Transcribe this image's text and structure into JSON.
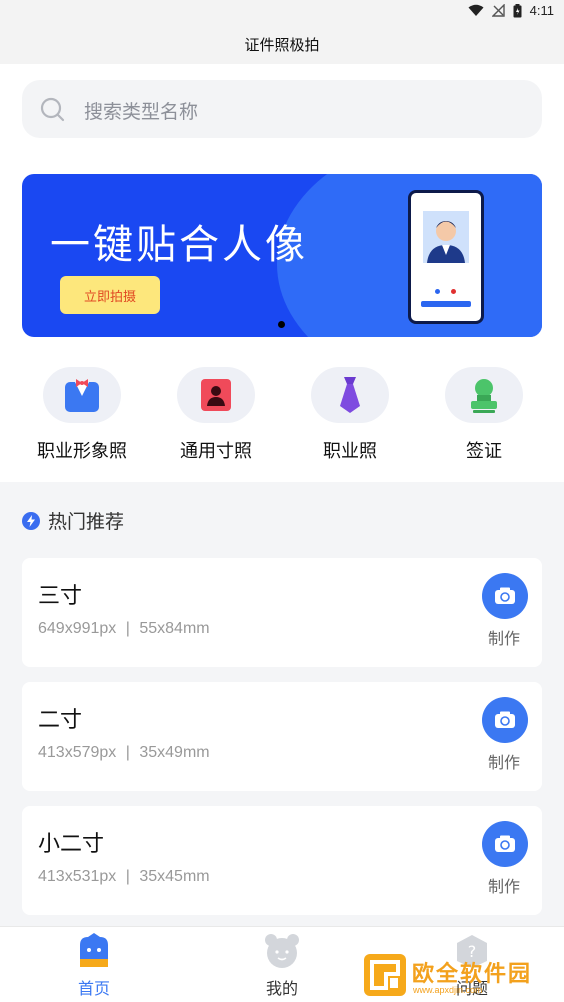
{
  "status": {
    "time": "4:11"
  },
  "header": {
    "title": "证件照极拍"
  },
  "search": {
    "placeholder": "搜索类型名称"
  },
  "banner": {
    "title": "一键贴合人像",
    "button_label": "立即拍摄",
    "colors": {
      "background": "#1a48f2",
      "button": "#fde77c"
    }
  },
  "categories": [
    {
      "label": "职业形象照",
      "icon": "suit-bowtie-icon"
    },
    {
      "label": "通用寸照",
      "icon": "id-photo-icon"
    },
    {
      "label": "职业照",
      "icon": "tie-icon"
    },
    {
      "label": "签证",
      "icon": "stamp-icon"
    }
  ],
  "section": {
    "title": "热门推荐"
  },
  "sizes": [
    {
      "name": "三寸",
      "pixels": "649x991px",
      "mm": "55x84mm",
      "action": "制作"
    },
    {
      "name": "二寸",
      "pixels": "413x579px",
      "mm": "35x49mm",
      "action": "制作"
    },
    {
      "name": "小二寸",
      "pixels": "413x531px",
      "mm": "35x45mm",
      "action": "制作"
    }
  ],
  "spec_separator": "|",
  "tabs": [
    {
      "label": "首页",
      "icon": "home-icon",
      "active": true
    },
    {
      "label": "我的",
      "icon": "bear-profile-icon",
      "active": false
    },
    {
      "label": "问题",
      "icon": "help-icon",
      "active": false
    }
  ],
  "watermark": {
    "text": "欧全软件园",
    "sub": "www.apxdjin.com"
  },
  "accent_color": "#3b78f2"
}
